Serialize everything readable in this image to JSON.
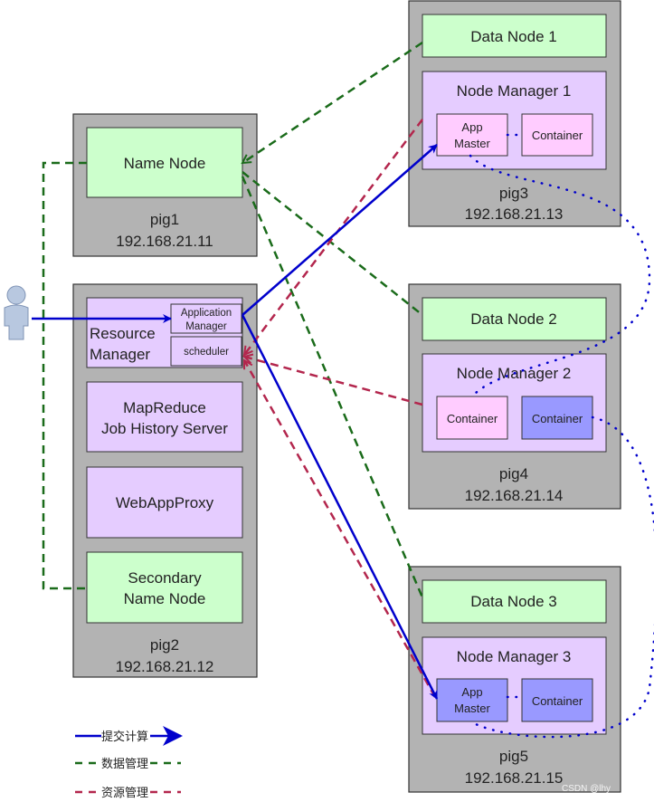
{
  "colors": {
    "server": "#b3b3b3",
    "data_node": "#ccffcc",
    "service": "#e5ccff",
    "app_master_pink": "#ffccff",
    "container_blue": "#9999ff",
    "submit_line": "#0000cc",
    "data_line": "#1a6b1a",
    "resource_line": "#b3264d"
  },
  "user_icon": "person-icon",
  "pig1": {
    "name": "pig1",
    "ip": "192.168.21.11",
    "name_node": "Name Node"
  },
  "pig2": {
    "name": "pig2",
    "ip": "192.168.21.12",
    "resource_manager_line1": "Resource",
    "resource_manager_line2": "Manager",
    "application_manager_line1": "Application",
    "application_manager_line2": "Manager",
    "scheduler": "scheduler",
    "job_history_line1": "MapReduce",
    "job_history_line2": "Job History Server",
    "web_app_proxy": "WebAppProxy",
    "secondary_line1": "Secondary",
    "secondary_line2": "Name Node"
  },
  "pig3": {
    "name": "pig3",
    "ip": "192.168.21.13",
    "data_node": "Data Node 1",
    "node_manager": "Node Manager 1",
    "app_master_line1": "App",
    "app_master_line2": "Master",
    "container": "Container"
  },
  "pig4": {
    "name": "pig4",
    "ip": "192.168.21.14",
    "data_node": "Data Node 2",
    "node_manager": "Node Manager 2",
    "container_a": "Container",
    "container_b": "Container"
  },
  "pig5": {
    "name": "pig5",
    "ip": "192.168.21.15",
    "data_node": "Data Node 3",
    "node_manager": "Node Manager 3",
    "app_master_line1": "App",
    "app_master_line2": "Master",
    "container": "Container"
  },
  "legend": {
    "submit": "提交计算",
    "data": "数据管理",
    "resource": "资源管理"
  },
  "watermark": "CSDN @lhy"
}
